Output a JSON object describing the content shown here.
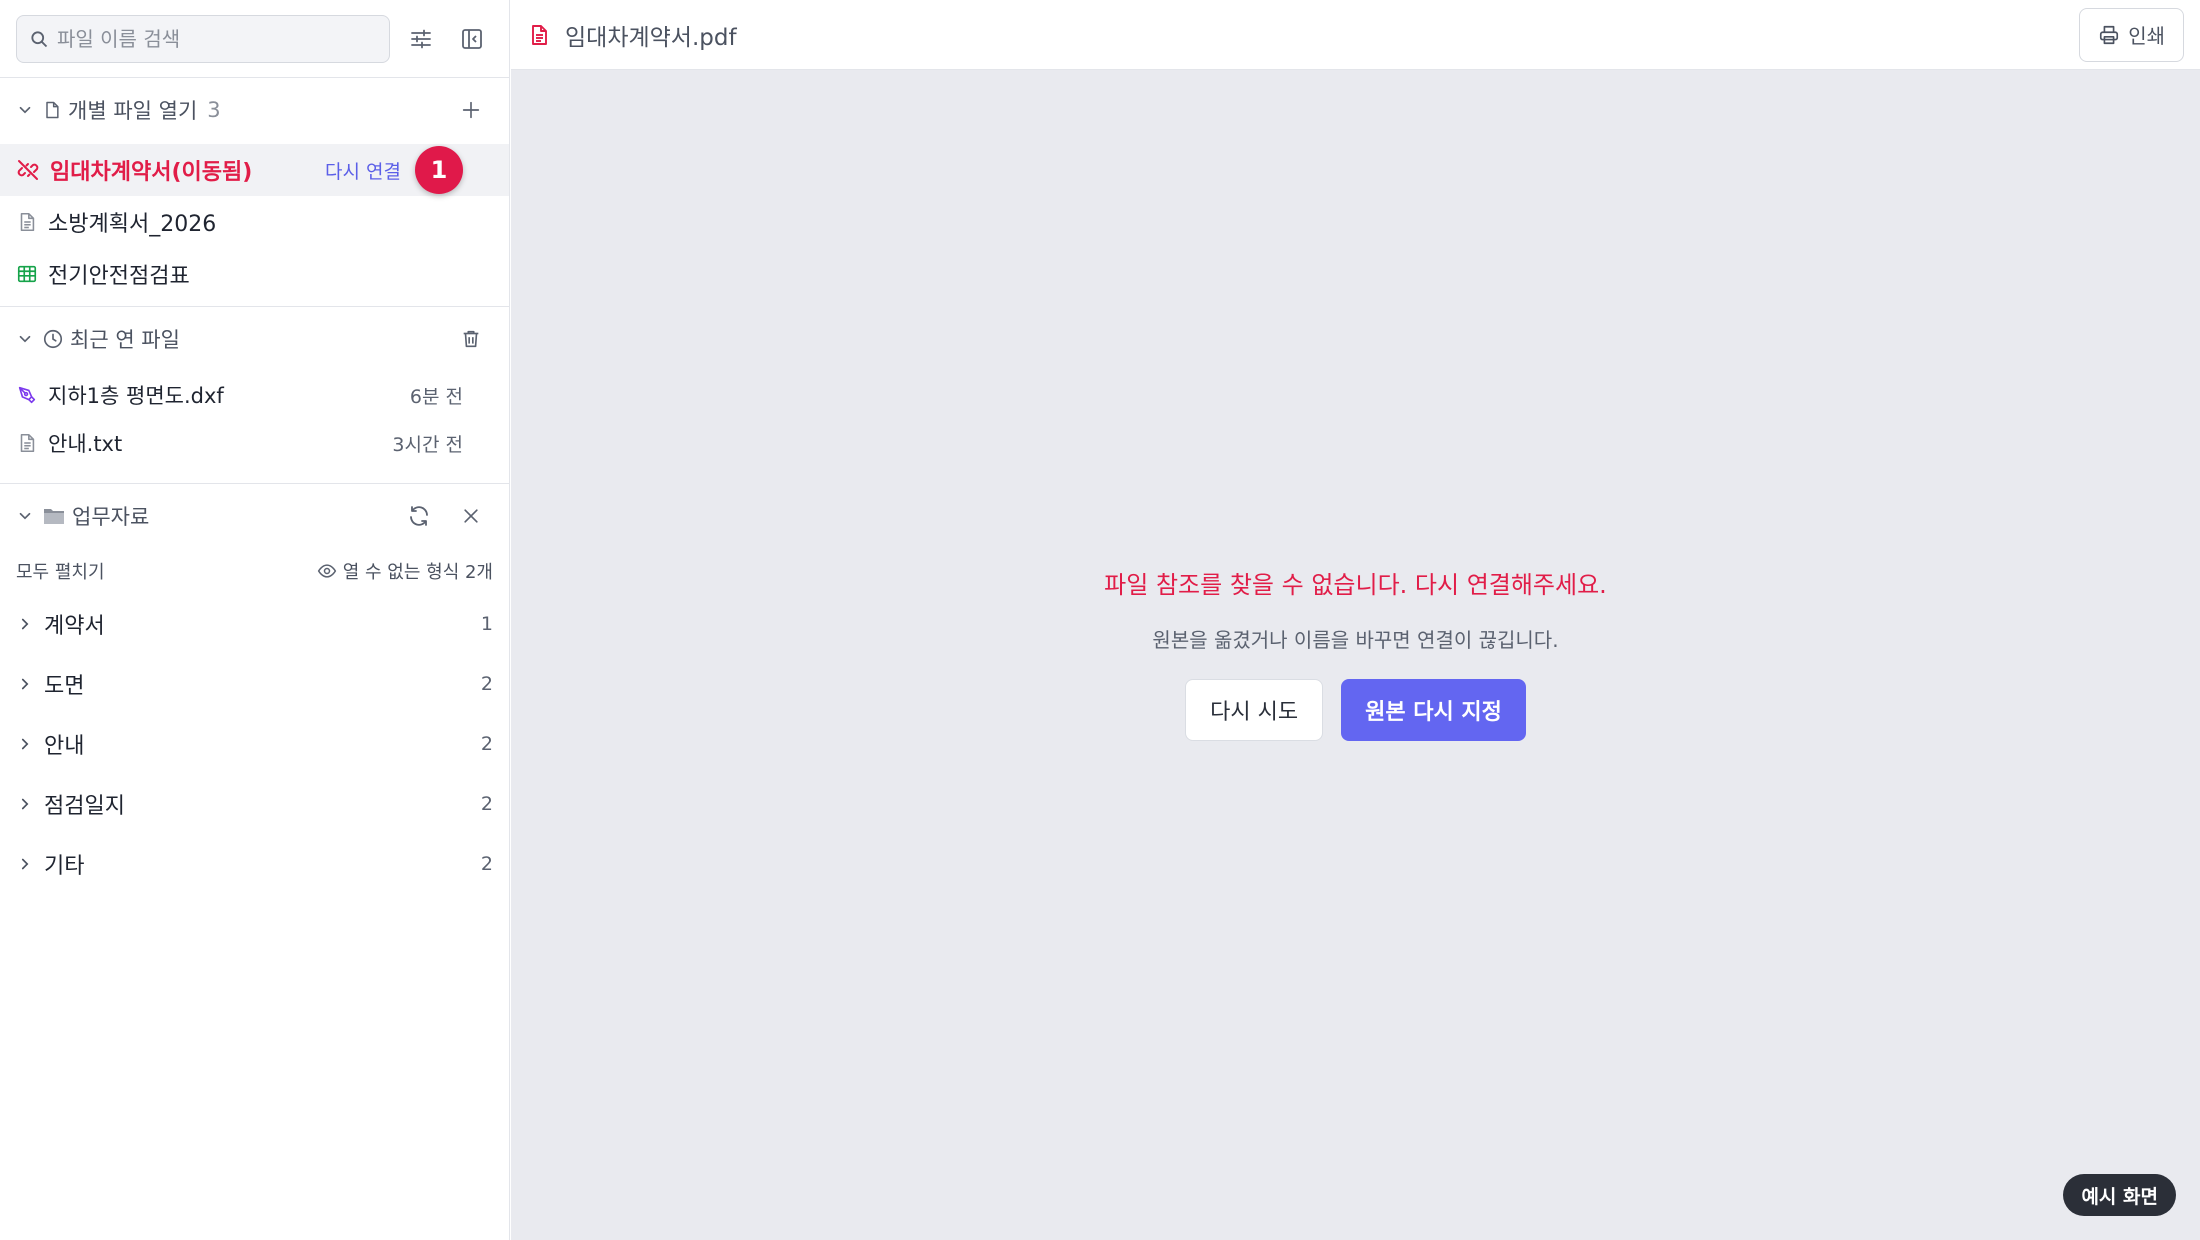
{
  "search": {
    "placeholder": "파일 이름 검색"
  },
  "open_files": {
    "title": "개별 파일 열기",
    "count": "3",
    "items": [
      {
        "name": "임대차계약서(이동됨)",
        "action": "다시 연결",
        "badge": "1"
      },
      {
        "name": "소방계획서_2026"
      },
      {
        "name": "전기안전점검표"
      }
    ]
  },
  "recent": {
    "title": "최근 연 파일",
    "items": [
      {
        "name": "지하1층 평면도.dxf",
        "time": "6분 전"
      },
      {
        "name": "안내.txt",
        "time": "3시간 전"
      }
    ]
  },
  "folder": {
    "title": "업무자료",
    "expand_all": "모두 펼치기",
    "hidden_formats": "열 수 없는 형식 2개",
    "items": [
      {
        "name": "계약서",
        "count": "1"
      },
      {
        "name": "도면",
        "count": "2"
      },
      {
        "name": "안내",
        "count": "2"
      },
      {
        "name": "점검일지",
        "count": "2"
      },
      {
        "name": "기타",
        "count": "2"
      }
    ]
  },
  "main": {
    "doc_title": "임대차계약서.pdf",
    "print_label": "인쇄",
    "error_message": "파일 참조를 찾을 수 없습니다. 다시 연결해주세요.",
    "error_hint": "원본을 옮겼거나 이름을 바꾸면 연결이 끊깁니다.",
    "retry_label": "다시 시도",
    "relocate_label": "원본 다시 지정"
  },
  "demo_tag": "예시 화면",
  "colors": {
    "accent": "#6366f1",
    "error": "#e11d48",
    "badge": "#e0194a",
    "sheet": "#16a34a",
    "cad": "#7c3aed"
  }
}
